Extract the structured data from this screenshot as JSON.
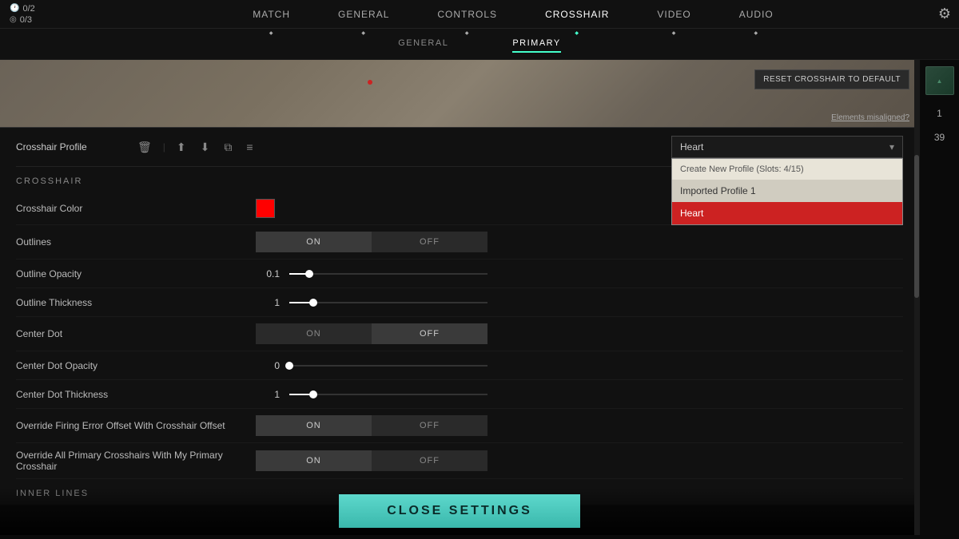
{
  "topNav": {
    "stats": {
      "kills": "0/2",
      "score": "0/3"
    },
    "tabs": [
      {
        "id": "match",
        "label": "MATCH",
        "active": false
      },
      {
        "id": "general",
        "label": "GENERAL",
        "active": false
      },
      {
        "id": "controls",
        "label": "CONTROLS",
        "active": false
      },
      {
        "id": "crosshair",
        "label": "CROSSHAIR",
        "active": true
      },
      {
        "id": "video",
        "label": "VIDEO",
        "active": false
      },
      {
        "id": "audio",
        "label": "AUDIO",
        "active": false
      }
    ],
    "gearIcon": "⚙"
  },
  "secondaryNav": {
    "tabs": [
      {
        "id": "general",
        "label": "GENERAL",
        "active": false
      },
      {
        "id": "primary",
        "label": "PRIMARY",
        "active": true
      }
    ]
  },
  "preview": {
    "resetButton": "RESET CROSSHAIR TO DEFAULT",
    "misalignedText": "Elements misaligned?"
  },
  "profileRow": {
    "label": "Crosshair Profile",
    "icons": {
      "delete": "🗑",
      "upload": "⬆",
      "download": "⬇",
      "copy": "⧉",
      "import": "≡"
    },
    "selectedValue": "Heart",
    "dropdownOpen": true,
    "dropdownOptions": [
      {
        "id": "create",
        "label": "Create New Profile (Slots: 4/15)",
        "type": "header"
      },
      {
        "id": "imported",
        "label": "Imported Profile 1",
        "type": "normal"
      },
      {
        "id": "heart",
        "label": "Heart",
        "type": "active"
      }
    ]
  },
  "crosshairSection": {
    "header": "CROSSHAIR",
    "settings": [
      {
        "id": "color",
        "label": "Crosshair Color",
        "type": "color",
        "value": "#ff0000"
      },
      {
        "id": "outlines",
        "label": "Outlines",
        "type": "toggle",
        "onActive": true,
        "offActive": false
      },
      {
        "id": "outlineOpacity",
        "label": "Outline Opacity",
        "type": "slider",
        "value": 0.1,
        "displayValue": "0.1",
        "fillPercent": 10
      },
      {
        "id": "outlineThickness",
        "label": "Outline Thickness",
        "type": "slider",
        "value": 1,
        "displayValue": "1",
        "fillPercent": 12
      },
      {
        "id": "centerDot",
        "label": "Center Dot",
        "type": "toggle",
        "onActive": false,
        "offActive": true
      },
      {
        "id": "centerDotOpacity",
        "label": "Center Dot Opacity",
        "type": "slider",
        "value": 0,
        "displayValue": "0",
        "fillPercent": 0
      },
      {
        "id": "centerDotThickness",
        "label": "Center Dot Thickness",
        "type": "slider",
        "value": 1,
        "displayValue": "1",
        "fillPercent": 12
      },
      {
        "id": "overrideFiring",
        "label": "Override Firing Error Offset With Crosshair Offset",
        "type": "toggle",
        "onActive": true,
        "offActive": false
      },
      {
        "id": "overrideAll",
        "label": "Override All Primary Crosshairs With My Primary Crosshair",
        "type": "toggle",
        "onActive": true,
        "offActive": false
      }
    ]
  },
  "innerLinesSection": {
    "header": "INNER LINES"
  },
  "closeSettings": {
    "label": "CLOSE SETTINGS"
  },
  "rightPanel": {
    "num1": "1",
    "num2": "39"
  },
  "labels": {
    "on": "On",
    "off": "Off"
  }
}
